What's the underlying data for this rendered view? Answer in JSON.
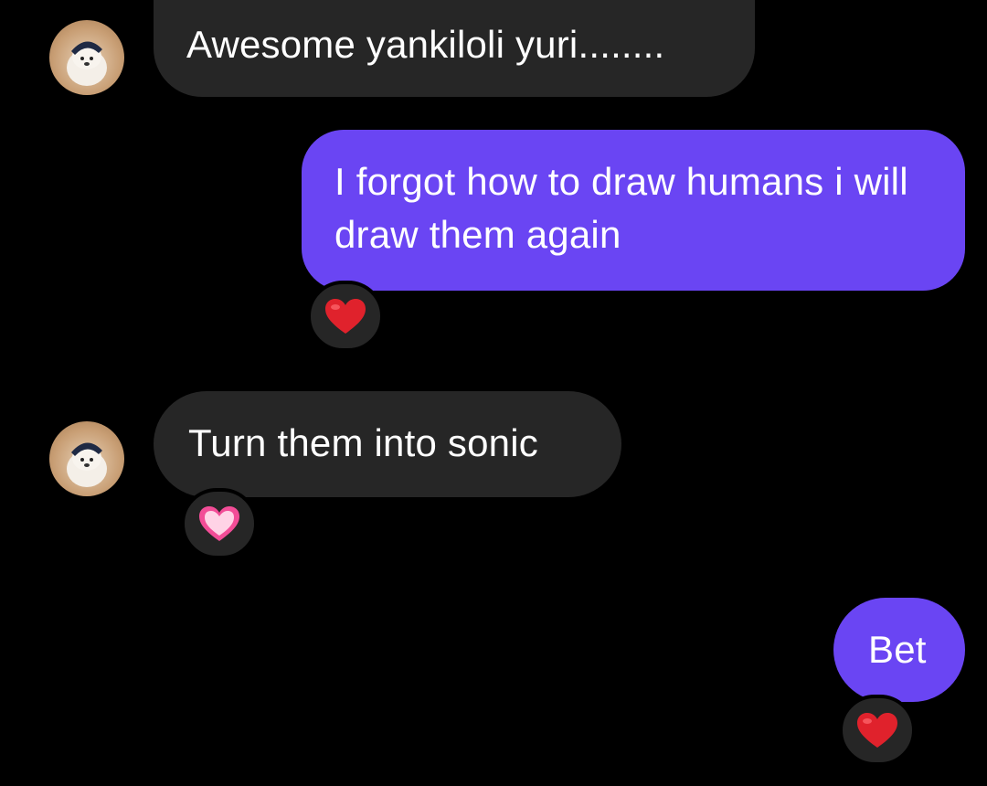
{
  "messages": [
    {
      "sender": "other",
      "text": "Awesome yankiloli yuri........"
    },
    {
      "sender": "me",
      "text": "I forgot how to draw humans i will draw them again",
      "reaction": "red-heart"
    },
    {
      "sender": "other",
      "text": "Turn them into sonic",
      "reaction": "pink-heart"
    },
    {
      "sender": "me",
      "text": "Bet",
      "reaction": "red-heart"
    }
  ],
  "colors": {
    "background": "#000000",
    "incoming_bubble": "#262626",
    "outgoing_bubble": "#6a45f3",
    "text": "#ffffff",
    "red_heart": "#e0222c",
    "pink_heart": "#f24d97"
  },
  "icons": {
    "avatar": "dog-avatar-icon",
    "reaction_red": "red-heart-icon",
    "reaction_pink": "pink-heart-icon"
  }
}
